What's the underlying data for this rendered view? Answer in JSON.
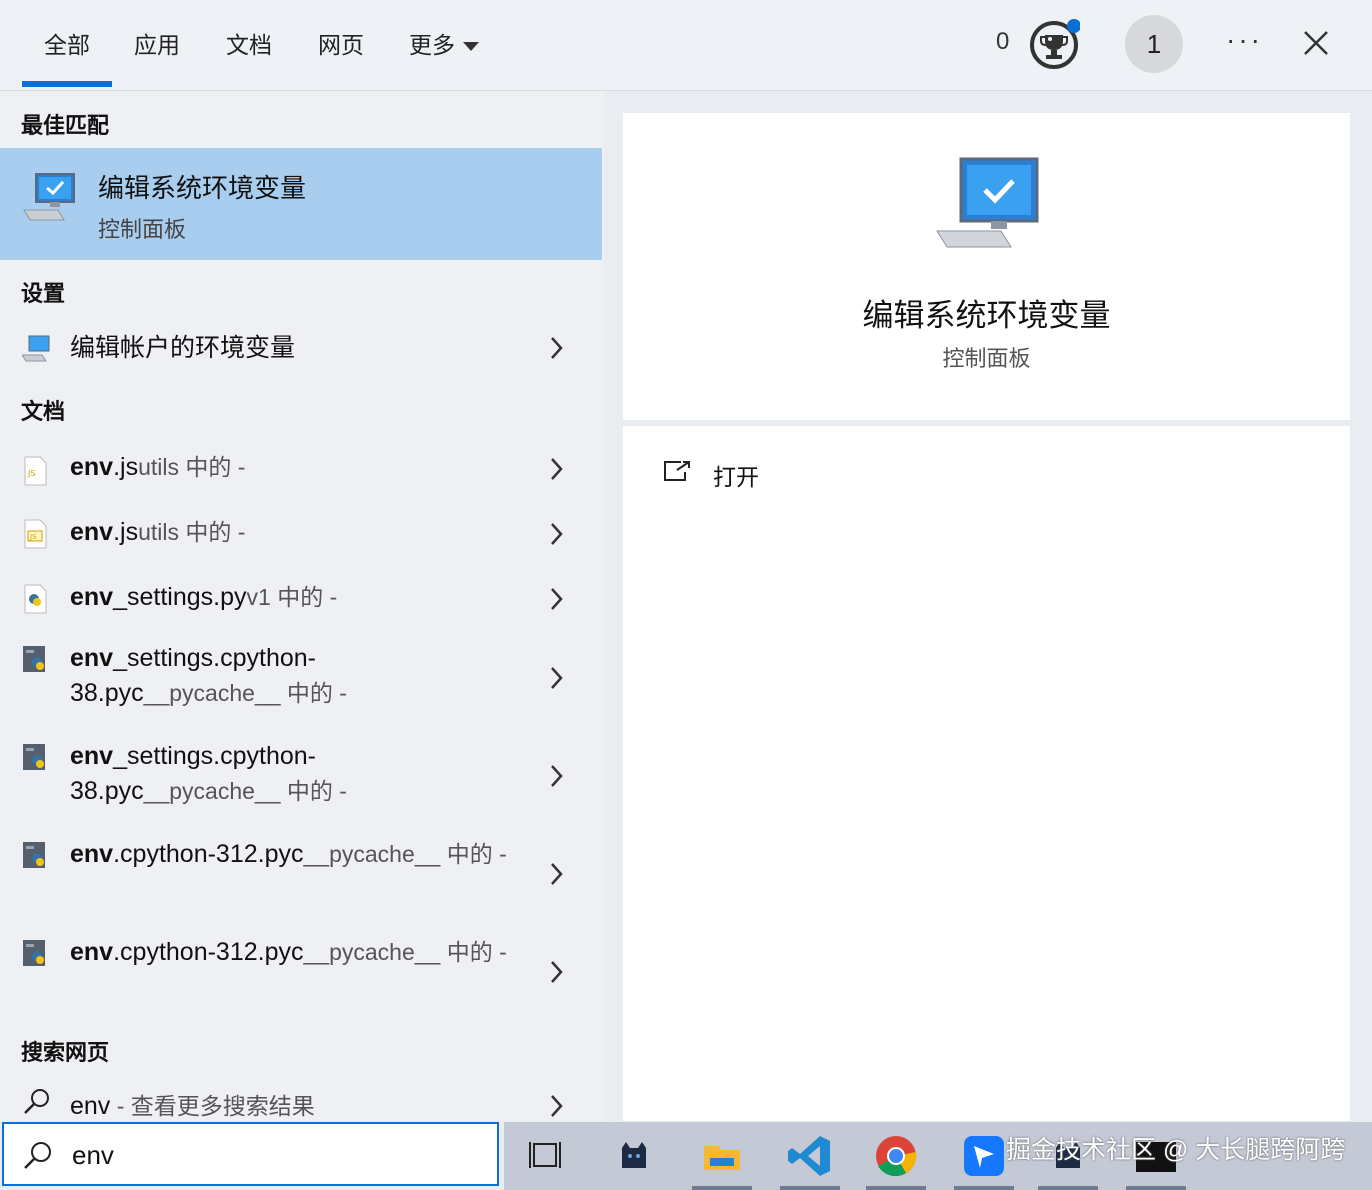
{
  "tabs": [
    {
      "label": "全部"
    },
    {
      "label": "应用"
    },
    {
      "label": "文档"
    },
    {
      "label": "网页"
    },
    {
      "label": "更多"
    }
  ],
  "header": {
    "points": "0",
    "avatar_text": "1",
    "more_label": "···"
  },
  "sections": {
    "best_match": "最佳匹配",
    "settings": "设置",
    "documents": "文档",
    "search_web": "搜索网页"
  },
  "best_match": {
    "title": "编辑系统环境变量",
    "subtitle": "控制面板"
  },
  "settings_item": {
    "label": "编辑帐户的环境变量"
  },
  "documents": [
    {
      "name_bold": "env",
      "name_rest": ".js",
      "location": "utils 中的 -"
    },
    {
      "name_bold": "env",
      "name_rest": ".js",
      "location": "utils 中的 -"
    },
    {
      "name_bold": "env",
      "name_rest": "_settings.py",
      "location": "v1 中的 -"
    },
    {
      "name_bold": "env",
      "name_rest": "_settings.cpython-38.pyc",
      "location": "__pycache__ 中的 -"
    },
    {
      "name_bold": "env",
      "name_rest": "_settings.cpython-38.pyc",
      "location": "__pycache__ 中的 -"
    },
    {
      "name_bold": "env",
      "name_rest": ".cpython-312.pyc",
      "location": "__pycache__ 中的 -"
    },
    {
      "name_bold": "env",
      "name_rest": ".cpython-312.pyc",
      "location": "__pycache__ 中的 -"
    }
  ],
  "web_item": {
    "query": "env",
    "suffix": " - 查看更多搜索结果"
  },
  "preview": {
    "title": "编辑系统环境变量",
    "subtitle": "控制面板",
    "open_label": "打开"
  },
  "search": {
    "value": "env"
  },
  "watermark": "掘金技术社区 @ 大长腿跨阿跨",
  "colors": {
    "accent": "#0a6fd6",
    "selection": "#a8cdee"
  }
}
